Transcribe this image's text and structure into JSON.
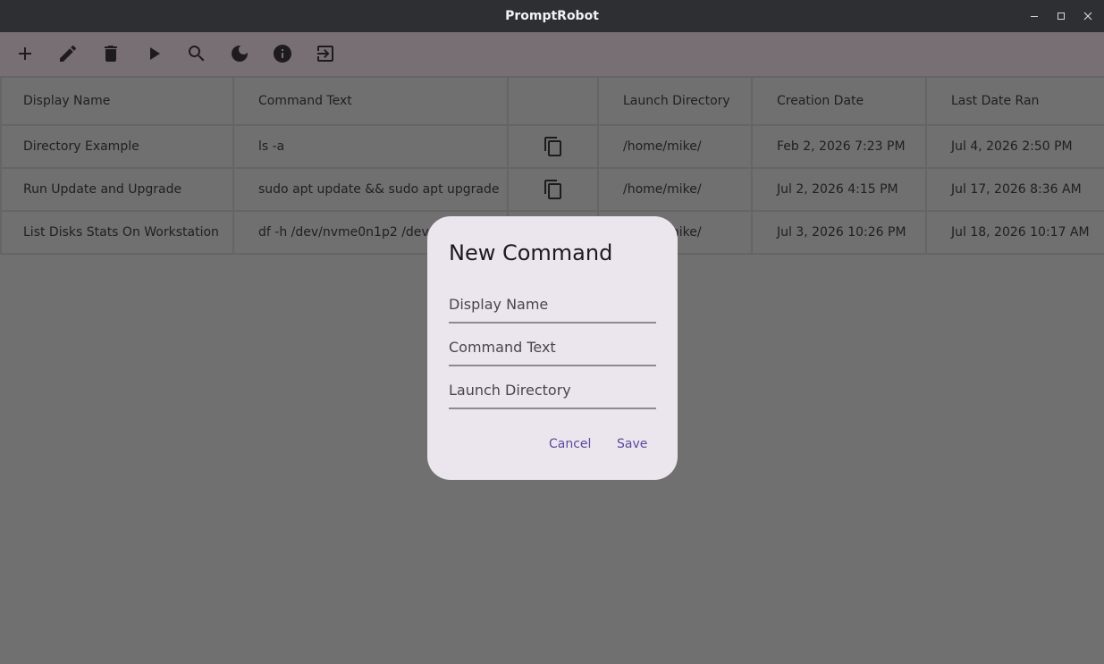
{
  "window": {
    "title": "PromptRobot",
    "controls": [
      "minimize-icon",
      "maximize-icon",
      "close-icon"
    ]
  },
  "toolbar": {
    "buttons": [
      {
        "name": "add",
        "icon": "plus-icon"
      },
      {
        "name": "edit",
        "icon": "pencil-icon"
      },
      {
        "name": "delete",
        "icon": "trash-icon"
      },
      {
        "name": "run",
        "icon": "play-icon"
      },
      {
        "name": "search",
        "icon": "search-icon"
      },
      {
        "name": "theme",
        "icon": "moon-icon"
      },
      {
        "name": "info",
        "icon": "info-icon"
      },
      {
        "name": "exit",
        "icon": "exit-icon"
      }
    ]
  },
  "table": {
    "headers": [
      "Display Name",
      "Command Text",
      "",
      "Launch Directory",
      "Creation Date",
      "Last Date Ran"
    ],
    "rows": [
      {
        "display_name": "Directory Example",
        "command_text": "ls -a",
        "launch_directory": "/home/mike/",
        "creation_date": "Feb 2, 2026 7:23 PM",
        "last_date_ran": "Jul 4, 2026 2:50 PM"
      },
      {
        "display_name": "Run Update and Upgrade",
        "command_text": "sudo apt update && sudo apt upgrade",
        "launch_directory": "/home/mike/",
        "creation_date": "Jul 2, 2026 4:15 PM",
        "last_date_ran": "Jul 17, 2026 8:36 AM"
      },
      {
        "display_name": "List Disks Stats On Workstation",
        "command_text": "df -h /dev/nvme0n1p2 /dev/sd",
        "launch_directory": "/home/mike/",
        "creation_date": "Jul 3, 2026 10:26 PM",
        "last_date_ran": "Jul 18, 2026 10:17 AM"
      }
    ]
  },
  "dialog": {
    "title": "New Command",
    "fields": {
      "display_name": {
        "placeholder": "Display Name",
        "value": ""
      },
      "command_text": {
        "placeholder": "Command Text",
        "value": ""
      },
      "launch_directory": {
        "placeholder": "Launch Directory",
        "value": ""
      }
    },
    "cancel_label": "Cancel",
    "save_label": "Save"
  },
  "colors": {
    "titlebar": "#2e2f33",
    "toolbar": "#786f74",
    "scrim": "#707070",
    "dialog_bg": "#ebe5ee",
    "accent": "#5a4a9a"
  }
}
